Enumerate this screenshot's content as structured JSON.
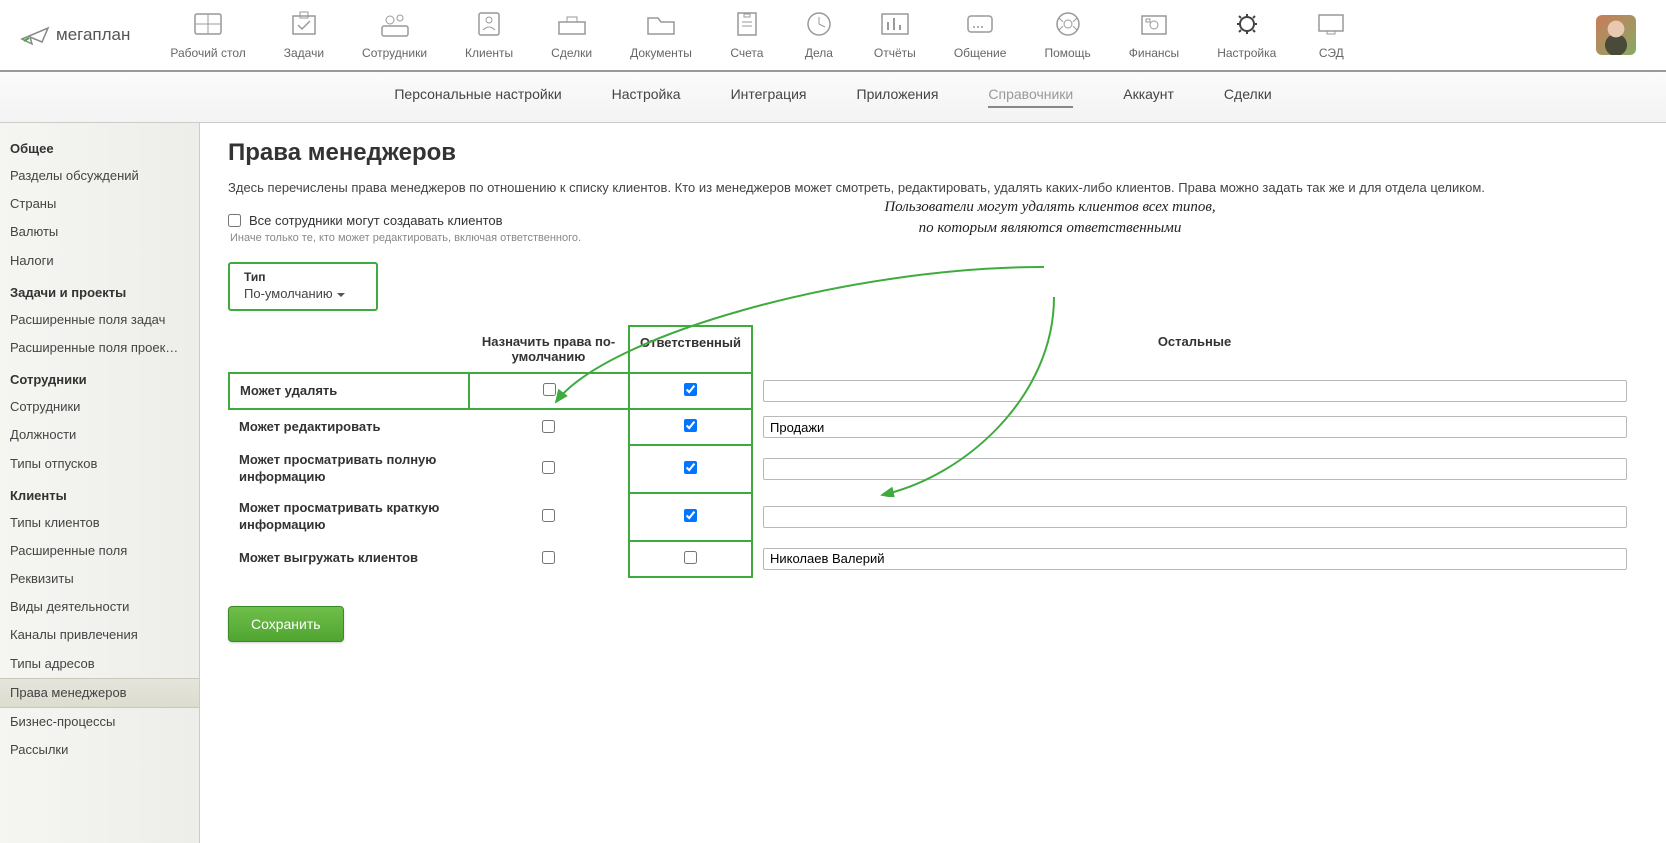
{
  "logo_text": "мегаплан",
  "top_nav": [
    {
      "label": "Рабочий стол"
    },
    {
      "label": "Задачи"
    },
    {
      "label": "Сотрудники"
    },
    {
      "label": "Клиенты"
    },
    {
      "label": "Сделки"
    },
    {
      "label": "Документы"
    },
    {
      "label": "Счета"
    },
    {
      "label": "Дела"
    },
    {
      "label": "Отчёты"
    },
    {
      "label": "Общение"
    },
    {
      "label": "Помощь"
    },
    {
      "label": "Финансы"
    },
    {
      "label": "Настройка"
    },
    {
      "label": "СЭД"
    }
  ],
  "sub_nav": {
    "items": [
      "Персональные настройки",
      "Настройка",
      "Интеграция",
      "Приложения",
      "Справочники",
      "Аккаунт",
      "Сделки"
    ],
    "active_index": 4
  },
  "sidebar": [
    {
      "title": "Общее",
      "items": [
        "Разделы обсуждений",
        "Страны",
        "Валюты",
        "Налоги"
      ]
    },
    {
      "title": "Задачи и проекты",
      "items": [
        "Расширенные поля задач",
        "Расширенные поля проек…"
      ]
    },
    {
      "title": "Сотрудники",
      "items": [
        "Сотрудники",
        "Должности",
        "Типы отпусков"
      ]
    },
    {
      "title": "Клиенты",
      "items": [
        "Типы клиентов",
        "Расширенные поля",
        "Реквизиты",
        "Виды деятельности",
        "Каналы привлечения",
        "Типы адресов",
        "Права менеджеров",
        "Бизнес-процессы",
        "Рассылки"
      ]
    }
  ],
  "sidebar_active": "Права менеджеров",
  "page": {
    "title": "Права менеджеров",
    "description": "Здесь перечислены права менеджеров по отношению к списку клиентов. Кто из менеджеров может смотреть, редактировать, удалять каких-либо клиентов. Права можно задать так же и для отдела целиком.",
    "all_create_label": "Все сотрудники могут создавать клиентов",
    "hint": "Иначе только те, кто может редактировать, включая ответственного.",
    "type_label": "Тип",
    "type_value": "По-умолчанию",
    "columns": {
      "assign": "Назначить права по-умолчанию",
      "responsible": "Ответственный",
      "others": "Остальные"
    },
    "rows": [
      {
        "label": "Может удалять",
        "assign": false,
        "responsible": true,
        "others": ""
      },
      {
        "label": "Может редактировать",
        "assign": false,
        "responsible": true,
        "others": "Продажи"
      },
      {
        "label": "Может просматривать полную информацию",
        "assign": false,
        "responsible": true,
        "others": ""
      },
      {
        "label": "Может просматривать краткую информацию",
        "assign": false,
        "responsible": true,
        "others": ""
      },
      {
        "label": "Может выгружать клиентов",
        "assign": false,
        "responsible": false,
        "others": "Николаев Валерий"
      }
    ],
    "save": "Сохранить"
  },
  "annotation": {
    "line1": "Пользователи могут удалять клиентов всех типов,",
    "line2": "по которым являются ответственными"
  }
}
